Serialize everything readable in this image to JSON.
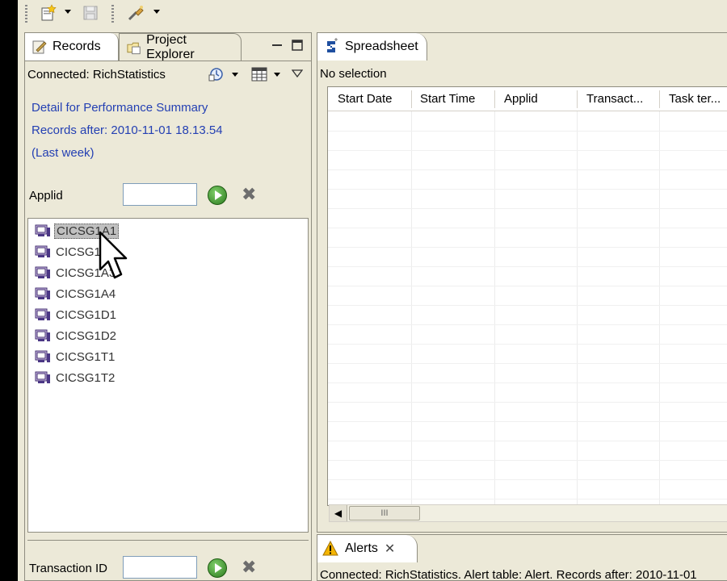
{
  "toolbar": {
    "icons": [
      "new-wizard-icon",
      "save-icon",
      "tools-icon"
    ]
  },
  "records_view": {
    "tabs": [
      {
        "label": "Records",
        "icon": "records-icon",
        "active": true
      },
      {
        "label": "Project Explorer",
        "icon": "project-explorer-icon",
        "active": false
      }
    ],
    "connection": "Connected: RichStatistics",
    "detail_lines": [
      "Detail for Performance Summary",
      "Records after: 2010-11-01 18.13.54",
      "(Last week)"
    ],
    "applid_label": "Applid",
    "applid_value": "",
    "regions": [
      {
        "name": "CICSG1A1",
        "selected": true
      },
      {
        "name": "CICSG1A2",
        "selected": false
      },
      {
        "name": "CICSG1A3",
        "selected": false
      },
      {
        "name": "CICSG1A4",
        "selected": false
      },
      {
        "name": "CICSG1D1",
        "selected": false
      },
      {
        "name": "CICSG1D2",
        "selected": false
      },
      {
        "name": "CICSG1T1",
        "selected": false
      },
      {
        "name": "CICSG1T2",
        "selected": false
      }
    ],
    "transaction_label": "Transaction ID",
    "transaction_value": ""
  },
  "spreadsheet_view": {
    "tab_label": "Spreadsheet",
    "status": "No selection",
    "columns": [
      "Start Date",
      "Start Time",
      "Applid",
      "Transact...",
      "Task ter..."
    ],
    "scroll_thumb": "III"
  },
  "alerts_view": {
    "tab_label": "Alerts",
    "status": "Connected: RichStatistics. Alert table: Alert. Records after: 2010-11-01"
  },
  "colors": {
    "detail_link": "#2440b3",
    "background": "#ece9d8",
    "go_button": "#2c7a1e"
  }
}
